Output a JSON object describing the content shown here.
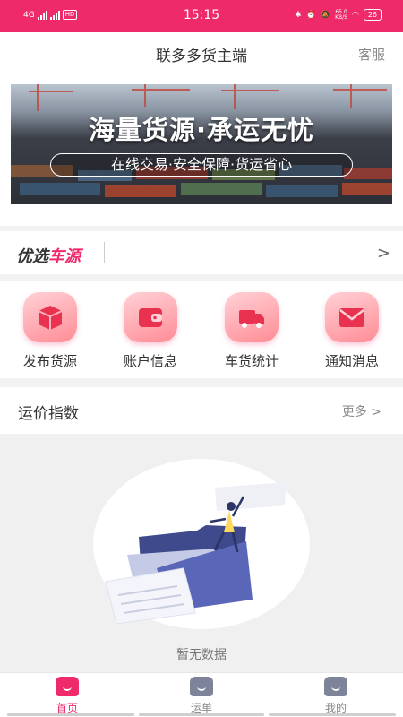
{
  "status_bar": {
    "network": "4G",
    "hd": "HD",
    "time": "15:15",
    "speed": "65.0",
    "speed_unit": "KB/S",
    "battery": "26"
  },
  "header": {
    "title": "联多多货主端",
    "service_label": "客服"
  },
  "banner": {
    "headline": "海量货源·承运无忧",
    "subline": "在线交易·安全保障·货运省心"
  },
  "preferred": {
    "logo_part1": "优选",
    "logo_part2": "车源"
  },
  "quick_actions": [
    {
      "label": "发布货源",
      "icon": "box-icon"
    },
    {
      "label": "账户信息",
      "icon": "wallet-icon"
    },
    {
      "label": "车货统计",
      "icon": "truck-icon"
    },
    {
      "label": "通知消息",
      "icon": "mail-icon"
    }
  ],
  "price_index": {
    "title": "运价指数",
    "more_label": "更多"
  },
  "empty_state": {
    "message": "暂无数据"
  },
  "tabbar": {
    "items": [
      {
        "label": "首页",
        "active": true
      },
      {
        "label": "运单",
        "active": false
      },
      {
        "label": "我的",
        "active": false
      }
    ]
  },
  "colors": {
    "brand": "#ee2a6b",
    "icon_bg": "#ff8c95",
    "inactive_icon": "#7d8499"
  }
}
